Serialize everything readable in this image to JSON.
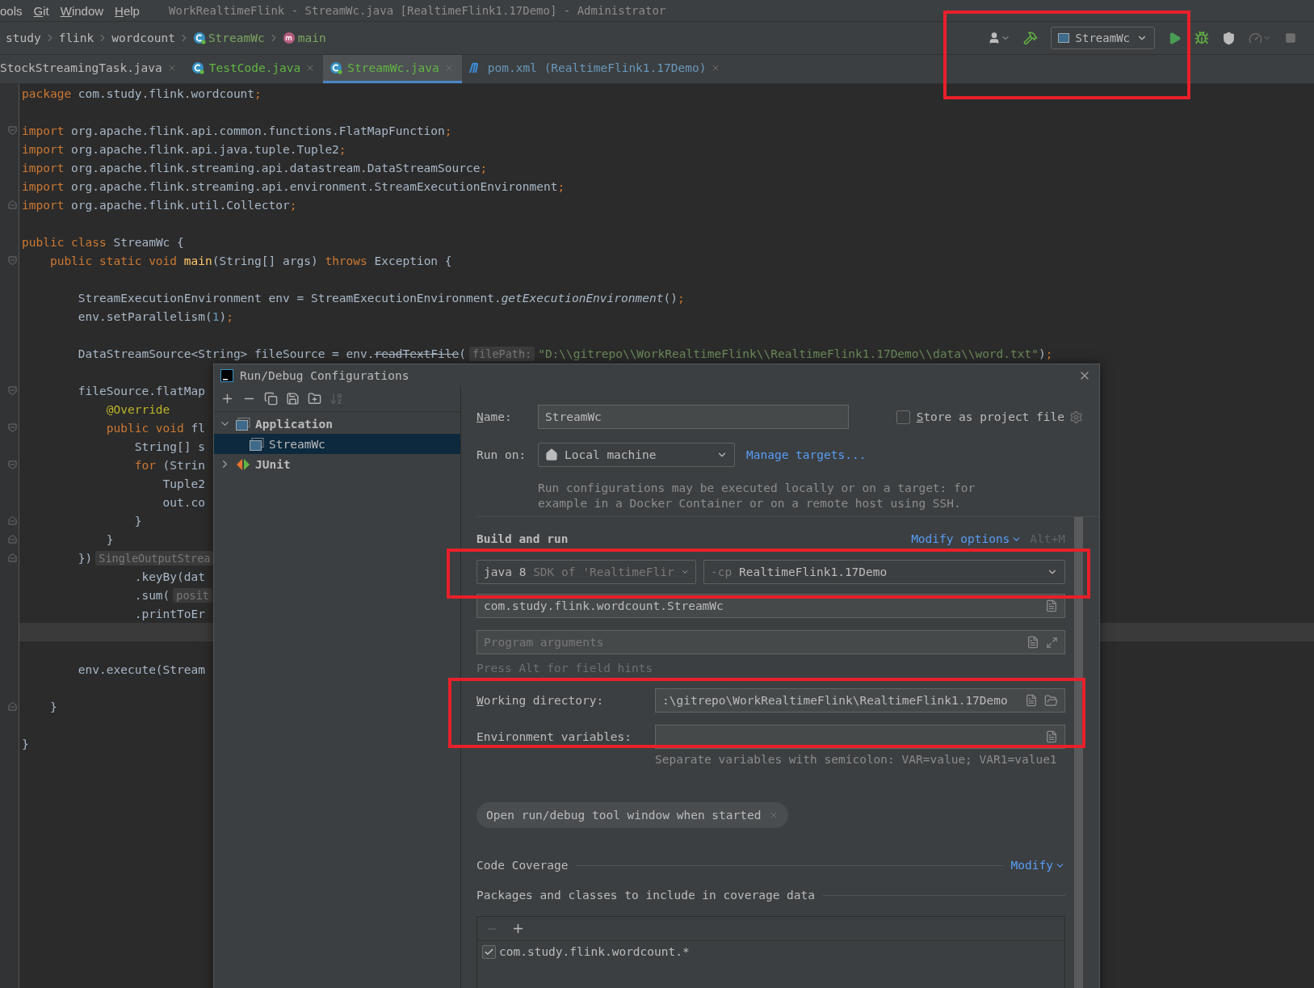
{
  "menu_bar": {
    "items": [
      {
        "label": "ools",
        "mnemonic": false
      },
      {
        "label": "Git",
        "mnemonic": true
      },
      {
        "label": "Window",
        "mnemonic": true
      },
      {
        "label": "Help",
        "mnemonic": true
      }
    ],
    "title": "WorkRealtimeFlink - StreamWc.java [RealtimeFlink1.17Demo] - Administrator"
  },
  "breadcrumbs": [
    {
      "label": "study",
      "kind": "folder"
    },
    {
      "label": "flink",
      "kind": "folder"
    },
    {
      "label": "wordcount",
      "kind": "folder"
    },
    {
      "label": "StreamWc",
      "kind": "class"
    },
    {
      "label": "main",
      "kind": "method"
    }
  ],
  "toolbar": [
    {
      "kind": "account",
      "disabled": false
    },
    {
      "kind": "build",
      "disabled": false
    },
    {
      "kind": "config",
      "label": "StreamWc",
      "disabled": false
    },
    {
      "kind": "run",
      "disabled": false
    },
    {
      "kind": "debug",
      "disabled": false
    },
    {
      "kind": "coverage",
      "disabled": false
    },
    {
      "kind": "profile",
      "disabled": true
    },
    {
      "kind": "stop",
      "disabled": true
    }
  ],
  "tabs": [
    {
      "label": "StockStreamingTask.java",
      "kind": "none",
      "color": "#bbbbbb",
      "selected": false
    },
    {
      "label": "TestCode.java",
      "kind": "class",
      "color": "#62b543",
      "selected": false
    },
    {
      "label": "StreamWc.java",
      "kind": "class",
      "color": "#62b543",
      "selected": true
    },
    {
      "label": "pom.xml (RealtimeFlink1.17Demo)",
      "kind": "maven",
      "color": "#6897bb",
      "selected": false
    }
  ],
  "editor": {
    "lines": [
      {
        "kind": "plain",
        "current": false,
        "parts": [
          {
            "kind": "keyword",
            "text": "package"
          },
          {
            "kind": "plain",
            "text": " com.study.flink.wordcount"
          },
          {
            "kind": "keyword",
            "text": ";"
          }
        ]
      },
      {
        "kind": "plain",
        "current": false
      },
      {
        "kind": "fold_start",
        "current": false,
        "parts": [
          {
            "kind": "keyword",
            "text": "import"
          },
          {
            "kind": "plain",
            "text": " org.apache.flink.api.common.functions.FlatMapFunction"
          },
          {
            "kind": "keyword",
            "text": ";"
          }
        ]
      },
      {
        "kind": "plain",
        "current": false,
        "parts": [
          {
            "kind": "keyword",
            "text": "import"
          },
          {
            "kind": "plain",
            "text": " org.apache.flink.api.java.tuple.Tuple2"
          },
          {
            "kind": "keyword",
            "text": ";"
          }
        ]
      },
      {
        "kind": "plain",
        "current": false,
        "parts": [
          {
            "kind": "keyword",
            "text": "import"
          },
          {
            "kind": "plain",
            "text": " org.apache.flink.streaming.api.datastream.DataStreamSource"
          },
          {
            "kind": "keyword",
            "text": ";"
          }
        ]
      },
      {
        "kind": "plain",
        "current": false,
        "parts": [
          {
            "kind": "keyword",
            "text": "import"
          },
          {
            "kind": "plain",
            "text": " org.apache.flink.streaming.api.environment.StreamExecutionEnvironment"
          },
          {
            "kind": "keyword",
            "text": ";"
          }
        ]
      },
      {
        "kind": "fold_end",
        "current": false,
        "parts": [
          {
            "kind": "keyword",
            "text": "import"
          },
          {
            "kind": "plain",
            "text": " org.apache.flink.util.Collector"
          },
          {
            "kind": "keyword",
            "text": ";"
          }
        ]
      },
      {
        "kind": "plain",
        "current": false
      },
      {
        "kind": "plain",
        "current": false,
        "parts": [
          {
            "kind": "keyword",
            "text": "public class "
          },
          {
            "kind": "plain",
            "text": "StreamWc {"
          }
        ]
      },
      {
        "kind": "fold_start",
        "current": false,
        "parts": [
          {
            "kind": "keyword",
            "text": "    public static void "
          },
          {
            "kind": "method",
            "text": "main"
          },
          {
            "kind": "plain",
            "text": "(String[] args) "
          },
          {
            "kind": "keyword",
            "text": "throws"
          },
          {
            "kind": "plain",
            "text": " Exception {"
          }
        ]
      },
      {
        "kind": "plain",
        "current": false
      },
      {
        "kind": "plain",
        "current": false,
        "parts": [
          {
            "kind": "plain",
            "text": "        StreamExecutionEnvironment env = StreamExecutionEnvironment."
          },
          {
            "kind": "italic",
            "text": "getExecutionEnvironment"
          },
          {
            "kind": "plain",
            "text": "()"
          },
          {
            "kind": "keyword",
            "text": ";"
          }
        ]
      },
      {
        "kind": "plain",
        "current": false,
        "parts": [
          {
            "kind": "plain",
            "text": "        env.setParallelism("
          },
          {
            "kind": "number",
            "text": "1"
          },
          {
            "kind": "plain",
            "text": ")"
          },
          {
            "kind": "keyword",
            "text": ";"
          }
        ]
      },
      {
        "kind": "plain",
        "current": false
      },
      {
        "kind": "plain",
        "current": false,
        "parts": [
          {
            "kind": "plain",
            "text": "        DataStreamSource<String> fileSource = env."
          },
          {
            "kind": "strike",
            "text": "readTextFile"
          },
          {
            "kind": "plain",
            "text": "("
          },
          {
            "kind": "hint",
            "text": "filePath:"
          },
          {
            "kind": "string",
            "text": "\"D:\\\\gitrepo\\\\WorkRealtimeFlink\\\\RealtimeFlink1.17Demo\\\\data\\\\word.txt\""
          },
          {
            "kind": "plain",
            "text": ")"
          },
          {
            "kind": "keyword",
            "text": ";"
          }
        ]
      },
      {
        "kind": "plain",
        "current": false
      },
      {
        "kind": "fold_start",
        "current": false,
        "parts": [
          {
            "kind": "plain",
            "text": "        fileSource.flatMap"
          }
        ]
      },
      {
        "kind": "plain",
        "current": false,
        "parts": [
          {
            "kind": "annotation",
            "text": "            @Override"
          }
        ]
      },
      {
        "kind": "fold_start",
        "current": false,
        "parts": [
          {
            "kind": "keyword",
            "text": "            public void "
          },
          {
            "kind": "plain",
            "text": "fl"
          }
        ]
      },
      {
        "kind": "plain",
        "current": false,
        "parts": [
          {
            "kind": "plain",
            "text": "                String[] s"
          }
        ]
      },
      {
        "kind": "fold_start",
        "current": false,
        "parts": [
          {
            "kind": "keyword",
            "text": "                for "
          },
          {
            "kind": "plain",
            "text": "(Strin"
          }
        ]
      },
      {
        "kind": "plain",
        "current": false,
        "parts": [
          {
            "kind": "plain",
            "text": "                    Tuple2"
          }
        ]
      },
      {
        "kind": "plain",
        "current": false,
        "parts": [
          {
            "kind": "plain",
            "text": "                    out.co"
          }
        ]
      },
      {
        "kind": "fold_end",
        "current": false,
        "parts": [
          {
            "kind": "plain",
            "text": "                }"
          }
        ]
      },
      {
        "kind": "fold_end",
        "current": false,
        "parts": [
          {
            "kind": "plain",
            "text": "            }"
          }
        ]
      },
      {
        "kind": "fold_end",
        "current": false,
        "parts": [
          {
            "kind": "plain",
            "text": "        })"
          },
          {
            "kind": "hint",
            "text": "SingleOutputStrea"
          }
        ]
      },
      {
        "kind": "plain",
        "current": false,
        "parts": [
          {
            "kind": "plain",
            "text": "                .keyBy(dat"
          }
        ]
      },
      {
        "kind": "plain",
        "current": false,
        "parts": [
          {
            "kind": "plain",
            "text": "                .sum("
          },
          {
            "kind": "hint",
            "text": "posit"
          }
        ]
      },
      {
        "kind": "plain",
        "current": false,
        "parts": [
          {
            "kind": "plain",
            "text": "                .printToEr"
          }
        ]
      },
      {
        "kind": "plain",
        "current": true
      },
      {
        "kind": "plain",
        "current": false
      },
      {
        "kind": "plain",
        "current": false,
        "parts": [
          {
            "kind": "plain",
            "text": "        env.execute(Stream"
          }
        ]
      },
      {
        "kind": "plain",
        "current": false
      },
      {
        "kind": "fold_end",
        "current": false,
        "parts": [
          {
            "kind": "plain",
            "text": "    }"
          }
        ]
      },
      {
        "kind": "plain",
        "current": false
      },
      {
        "kind": "plain",
        "current": false,
        "parts": [
          {
            "kind": "plain",
            "text": "}"
          }
        ]
      }
    ]
  },
  "dialog": {
    "title": "Run/Debug Configurations",
    "tree_toolbar": [
      {
        "kind": "add",
        "disabled": false
      },
      {
        "kind": "remove",
        "disabled": false
      },
      {
        "kind": "copy",
        "disabled": false
      },
      {
        "kind": "save",
        "disabled": false
      },
      {
        "kind": "folder",
        "disabled": false
      },
      {
        "kind": "sort",
        "disabled": true
      }
    ],
    "tree": [
      {
        "label": "Application",
        "kind": "application",
        "expanded": true,
        "selected": false,
        "children": [
          {
            "label": "StreamWc",
            "kind": "app_config",
            "selected": true
          }
        ]
      },
      {
        "label": "JUnit",
        "kind": "junit",
        "expanded": false,
        "selected": false
      }
    ],
    "name": {
      "label": "Name:",
      "mnemonic": true,
      "value": "StreamWc"
    },
    "store_as_project_file": {
      "label": "Store as project file",
      "mnemonic": true,
      "checked": false
    },
    "run_on": {
      "label": "Run on:",
      "value": "Local machine",
      "link": "Manage targets..."
    },
    "run_on_help": "Run configurations may be executed locally or on a target: for example in a Docker Container or on a remote host using SSH.",
    "build_and_run": {
      "title": "Build and run",
      "modify_link": "Modify options",
      "shortcut": "Alt+M",
      "sdk": {
        "value": "java 8",
        "detail": "SDK of 'RealtimeFlir"
      },
      "classpath": {
        "prefix": "-cp",
        "value": "RealtimeFlink1.17Demo"
      },
      "main_class": "com.study.flink.wordcount.StreamWc",
      "program_arguments": {
        "placeholder": "Program arguments"
      },
      "hint": "Press Alt for field hints"
    },
    "working_directory": {
      "label": "Working directory:",
      "mnemonic": true,
      "value": ":\\gitrepo\\WorkRealtimeFlink\\RealtimeFlink1.17Demo"
    },
    "environment_variables": {
      "label": "Environment variables:",
      "mnemonic": false,
      "hint": "Separate variables with semicolon: VAR=value; VAR1=value1"
    },
    "option_chips": [
      "Open run/debug tool window when started"
    ],
    "code_coverage": {
      "title": "Code Coverage",
      "modify_link": "Modify",
      "packages_title": "Packages and classes to include in coverage data",
      "patterns": [
        {
          "label": "com.study.flink.wordcount.*",
          "checked": true
        }
      ]
    }
  },
  "annotation_frames": [
    {
      "kind": "frame"
    },
    {
      "kind": "frame"
    },
    {
      "kind": "frame"
    }
  ]
}
